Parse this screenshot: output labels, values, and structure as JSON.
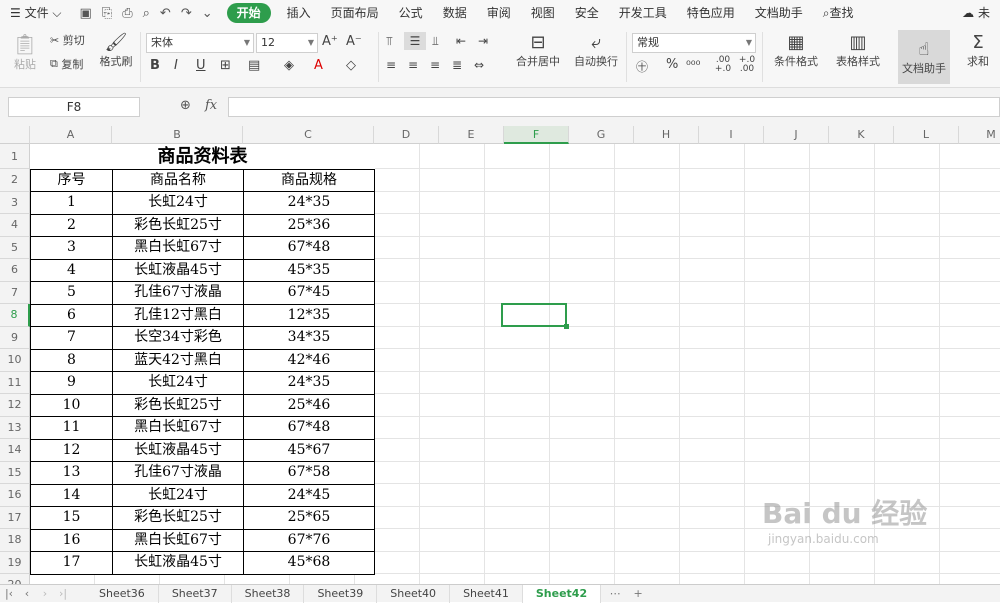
{
  "menu": {
    "file": "文件",
    "tabs": [
      "开始",
      "插入",
      "页面布局",
      "公式",
      "数据",
      "审阅",
      "视图",
      "安全",
      "开发工具",
      "特色应用",
      "文档助手"
    ],
    "search": "查找",
    "right": "未"
  },
  "ribbon": {
    "paste": "粘贴",
    "cut": "剪切",
    "copy": "复制",
    "format_painter": "格式刷",
    "font": "宋体",
    "size": "12",
    "merge": "合并居中",
    "wrap": "自动换行",
    "numfmt": "常规",
    "cond": "条件格式",
    "tablestyle": "表格样式",
    "docassist": "文档助手",
    "sum": "求和",
    "dec_inc": ".00 +.0",
    "dec_dec": "+.0 .00"
  },
  "namebox": "F8",
  "fx": "fx",
  "columns": [
    "A",
    "B",
    "C",
    "D",
    "E",
    "F",
    "G",
    "H",
    "I",
    "J",
    "K",
    "L",
    "M"
  ],
  "selected_column": "F",
  "selected_row": "8",
  "rows": [
    "1",
    "2",
    "3",
    "4",
    "5",
    "6",
    "7",
    "8",
    "9",
    "10",
    "11",
    "12",
    "13",
    "14",
    "15",
    "16",
    "17",
    "18",
    "19",
    "20"
  ],
  "table": {
    "title": "商品资料表",
    "headers": [
      "序号",
      "商品名称",
      "商品规格"
    ],
    "data": [
      [
        "1",
        "长虹24寸",
        "24*35"
      ],
      [
        "2",
        "彩色长虹25寸",
        "25*36"
      ],
      [
        "3",
        "黑白长虹67寸",
        "67*48"
      ],
      [
        "4",
        "长虹液晶45寸",
        "45*35"
      ],
      [
        "5",
        "孔佳67寸液晶",
        "67*45"
      ],
      [
        "6",
        "孔佳12寸黑白",
        "12*35"
      ],
      [
        "7",
        "长空34寸彩色",
        "34*35"
      ],
      [
        "8",
        "蓝天42寸黑白",
        "42*46"
      ],
      [
        "9",
        "长虹24寸",
        "24*35"
      ],
      [
        "10",
        "彩色长虹25寸",
        "25*46"
      ],
      [
        "11",
        "黑白长虹67寸",
        "67*48"
      ],
      [
        "12",
        "长虹液晶45寸",
        "45*67"
      ],
      [
        "13",
        "孔佳67寸液晶",
        "67*58"
      ],
      [
        "14",
        "长虹24寸",
        "24*45"
      ],
      [
        "15",
        "彩色长虹25寸",
        "25*65"
      ],
      [
        "16",
        "黑白长虹67寸",
        "67*76"
      ],
      [
        "17",
        "长虹液晶45寸",
        "45*68"
      ]
    ]
  },
  "sheets": [
    "Sheet36",
    "Sheet37",
    "Sheet38",
    "Sheet39",
    "Sheet40",
    "Sheet41",
    "Sheet42"
  ],
  "active_sheet": "Sheet42",
  "watermark": {
    "logo": "Bai du 经验",
    "url": "jingyan.baidu.com"
  },
  "accent": "#2e9d4c"
}
